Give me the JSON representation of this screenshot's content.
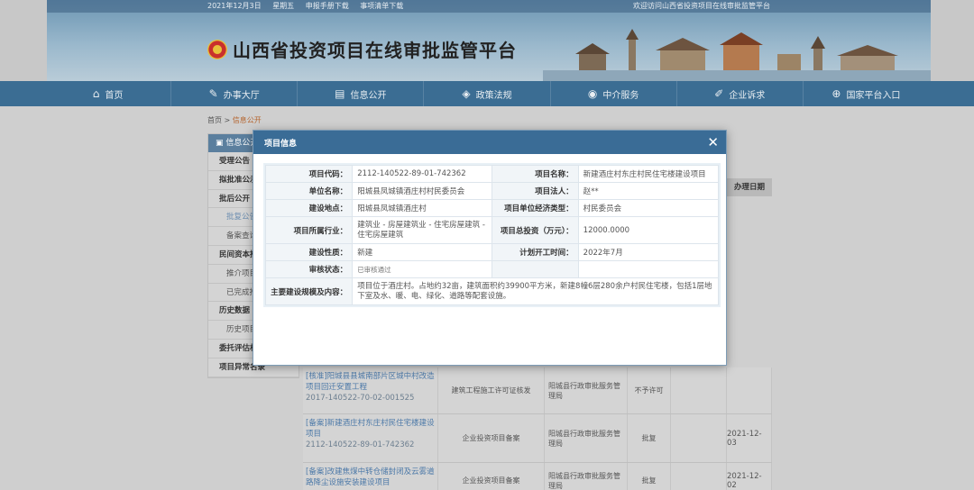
{
  "header": {
    "date": "2021年12月3日",
    "weekday": "星期五",
    "link_manual": "申报手册下载",
    "link_checklist": "事项清单下载",
    "welcome": "欢迎访问山西省投资项目在线审批监管平台",
    "title": "山西省投资项目在线审批监管平台"
  },
  "nav": [
    {
      "label": "首页",
      "icon": "home-icon"
    },
    {
      "label": "办事大厅",
      "icon": "edit-icon"
    },
    {
      "label": "信息公开",
      "icon": "document-icon"
    },
    {
      "label": "政策法规",
      "icon": "layers-icon"
    },
    {
      "label": "中介服务",
      "icon": "compass-icon"
    },
    {
      "label": "企业诉求",
      "icon": "pencil-icon"
    },
    {
      "label": "国家平台入口",
      "icon": "globe-icon"
    }
  ],
  "breadcrumb": {
    "home": "首页",
    "sep": ">",
    "current": "信息公开"
  },
  "sidebar": {
    "head": "信息公开",
    "items": [
      {
        "label": "受理公告",
        "sub": false
      },
      {
        "label": "拟批准公示",
        "sub": false
      },
      {
        "label": "批后公开",
        "sub": false
      },
      {
        "label": "批复公告",
        "sub": true,
        "active": true
      },
      {
        "label": "备案查询",
        "sub": true
      },
      {
        "label": "民间资本推介",
        "sub": false
      },
      {
        "label": "推介项目",
        "sub": true
      },
      {
        "label": "已完成推介",
        "sub": true
      },
      {
        "label": "历史数据",
        "sub": false
      },
      {
        "label": "历史项目",
        "sub": true
      },
      {
        "label": "委托评估机构",
        "sub": false
      },
      {
        "label": "项目异常名录",
        "sub": false
      }
    ]
  },
  "table": {
    "header_date": "办理日期",
    "rows": [
      {
        "name": "[核准]阳城县县城南部片区城中村改造项目回迁安置工程",
        "code": "2017-140522-70-02-001525",
        "type": "建筑工程施工许可证核发",
        "dept": "阳城县行政审批服务管理局",
        "result": "不予许可",
        "date": ""
      },
      {
        "name": "[备案]新建酒庄村东庄村民住宅楼建设项目",
        "code": "2112-140522-89-01-742362",
        "type": "企业投资项目备案",
        "dept": "阳城县行政审批服务管理局",
        "result": "批复",
        "date": "2021-12-03"
      },
      {
        "name": "[备案]改建焦煤中转仓储封闭及云雾道路降尘设施安装建设项目",
        "code": "",
        "type": "企业投资项目备案",
        "dept": "阳城县行政审批服务管理局",
        "result": "批复",
        "date": "2021-12-02"
      }
    ]
  },
  "modal": {
    "title": "项目信息",
    "close": "✕",
    "fields": {
      "code_label": "项目代码：",
      "code": "2112-140522-89-01-742362",
      "name_label": "项目名称：",
      "name": "新建酒庄村东庄村民住宅楼建设项目",
      "unit_label": "单位名称：",
      "unit": "阳城县凤城镇酒庄村村民委员会",
      "legal_label": "项目法人：",
      "legal": "赵**",
      "site_label": "建设地点：",
      "site": "阳城县凤城镇酒庄村",
      "econ_label": "项目单位经济类型：",
      "econ": "村民委员会",
      "industry_label": "项目所属行业：",
      "industry": "建筑业 - 房屋建筑业 - 住宅房屋建筑 - 住宅房屋建筑",
      "invest_label": "项目总投资（万元）：",
      "invest": "12000.0000",
      "nature_label": "建设性质：",
      "nature": "新建",
      "start_label": "计划开工时间：",
      "start": "2022年7月",
      "status_label": "审核状态：",
      "status": "已审核通过",
      "scale_label": "主要建设规模及内容：",
      "scale": "项目位于酒庄村。占地约32亩，建筑面积约39900平方米，新建8幢6层280余户村民住宅楼，包括1层地下室及水、暖、电、绿化、道路等配套设施。"
    }
  }
}
